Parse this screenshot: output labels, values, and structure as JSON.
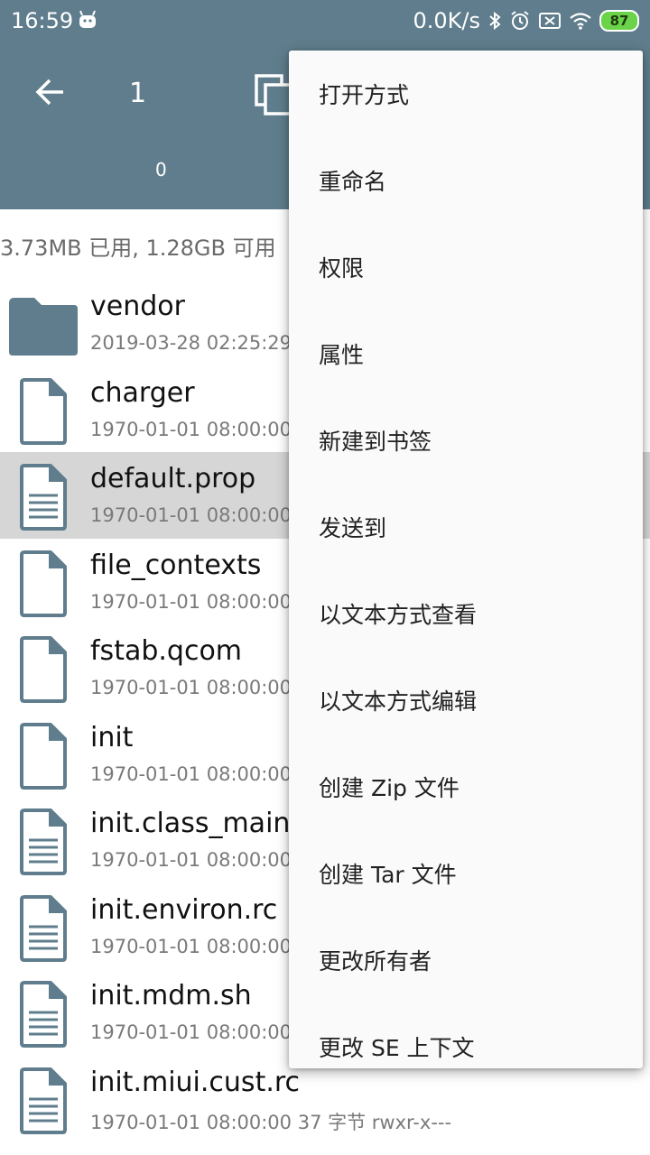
{
  "status_bar": {
    "time": "16:59",
    "network_speed": "0.0K/s",
    "battery_level": "87"
  },
  "toolbar": {
    "selected_count": "1",
    "tab_label": "0"
  },
  "storage_info": "3.73MB 已用, 1.28GB 可用",
  "files": [
    {
      "name": "vendor",
      "meta": "2019-03-28 02:25:29",
      "type": "folder",
      "selected": false
    },
    {
      "name": "charger",
      "meta": "1970-01-01 08:00:00",
      "type": "file",
      "selected": false
    },
    {
      "name": "default.prop",
      "meta": "1970-01-01 08:00:00",
      "type": "text",
      "selected": true
    },
    {
      "name": "file_contexts",
      "meta": "1970-01-01 08:00:00",
      "type": "file",
      "selected": false
    },
    {
      "name": "fstab.qcom",
      "meta": "1970-01-01 08:00:00",
      "type": "file",
      "selected": false
    },
    {
      "name": "init",
      "meta": "1970-01-01 08:00:00",
      "type": "file",
      "selected": false
    },
    {
      "name": "init.class_main",
      "meta": "1970-01-01 08:00:00",
      "type": "text",
      "selected": false
    },
    {
      "name": "init.environ.rc",
      "meta": "1970-01-01 08:00:00",
      "type": "text",
      "selected": false
    },
    {
      "name": "init.mdm.sh",
      "meta": "1970-01-01 08:00:00",
      "type": "text",
      "selected": false
    },
    {
      "name": "init.miui.cust.rc",
      "meta": "1970-01-01 08:00:00  37 字节  rwxr-x---",
      "type": "text",
      "selected": false
    }
  ],
  "menu": {
    "items": [
      "打开方式",
      "重命名",
      "权限",
      "属性",
      "新建到书签",
      "发送到",
      "以文本方式查看",
      "以文本方式编辑",
      "创建 Zip 文件",
      "创建 Tar 文件",
      "更改所有者",
      "更改 SE 上下文"
    ]
  },
  "colors": {
    "appbar": "#5f7d8c",
    "icon": "#5f7d8c",
    "selected_row": "#d6d6d6",
    "battery": "#6ad34a"
  }
}
